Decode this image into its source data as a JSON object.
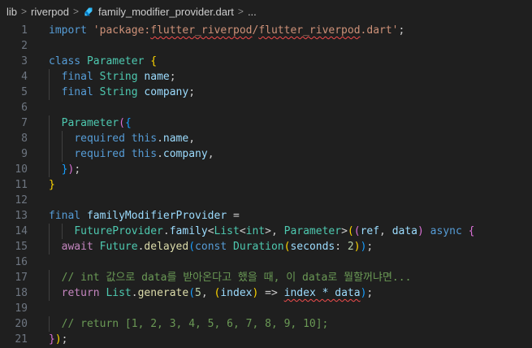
{
  "breadcrumb": {
    "items": [
      "lib",
      "riverpod",
      "family_modifier_provider.dart",
      "..."
    ],
    "separator": ">"
  },
  "editor": {
    "lines": [
      {
        "n": "1",
        "t": [
          [
            "kw",
            "import"
          ],
          [
            "punc",
            " "
          ],
          [
            "st",
            "'package:"
          ],
          [
            "st squig",
            "flutter_riverpod"
          ],
          [
            "st",
            "/"
          ],
          [
            "st squig",
            "flutter_riverpod"
          ],
          [
            "st",
            ".dart'"
          ],
          [
            "punc",
            ";"
          ]
        ]
      },
      {
        "n": "2",
        "t": []
      },
      {
        "n": "3",
        "t": [
          [
            "kw",
            "class"
          ],
          [
            "punc",
            " "
          ],
          [
            "ty",
            "Parameter"
          ],
          [
            "punc",
            " "
          ],
          [
            "br1",
            "{"
          ]
        ]
      },
      {
        "n": "4",
        "t": [
          [
            "punc",
            "  "
          ],
          [
            "kw",
            "final"
          ],
          [
            "punc",
            " "
          ],
          [
            "ty",
            "String"
          ],
          [
            "punc",
            " "
          ],
          [
            "var",
            "name"
          ],
          [
            "punc",
            ";"
          ]
        ]
      },
      {
        "n": "5",
        "t": [
          [
            "punc",
            "  "
          ],
          [
            "kw",
            "final"
          ],
          [
            "punc",
            " "
          ],
          [
            "ty",
            "String"
          ],
          [
            "punc",
            " "
          ],
          [
            "var",
            "company"
          ],
          [
            "punc",
            ";"
          ]
        ]
      },
      {
        "n": "6",
        "t": []
      },
      {
        "n": "7",
        "t": [
          [
            "punc",
            "  "
          ],
          [
            "ty",
            "Parameter"
          ],
          [
            "br2",
            "("
          ],
          [
            "br3",
            "{"
          ]
        ]
      },
      {
        "n": "8",
        "t": [
          [
            "punc",
            "    "
          ],
          [
            "kw",
            "required"
          ],
          [
            "punc",
            " "
          ],
          [
            "kw",
            "this"
          ],
          [
            "punc",
            "."
          ],
          [
            "var",
            "name"
          ],
          [
            "punc",
            ","
          ]
        ]
      },
      {
        "n": "9",
        "t": [
          [
            "punc",
            "    "
          ],
          [
            "kw",
            "required"
          ],
          [
            "punc",
            " "
          ],
          [
            "kw",
            "this"
          ],
          [
            "punc",
            "."
          ],
          [
            "var",
            "company"
          ],
          [
            "punc",
            ","
          ]
        ]
      },
      {
        "n": "10",
        "t": [
          [
            "punc",
            "  "
          ],
          [
            "br3",
            "}"
          ],
          [
            "br2",
            ")"
          ],
          [
            "punc",
            ";"
          ]
        ]
      },
      {
        "n": "11",
        "t": [
          [
            "br1",
            "}"
          ]
        ]
      },
      {
        "n": "12",
        "t": []
      },
      {
        "n": "13",
        "t": [
          [
            "kw",
            "final"
          ],
          [
            "punc",
            " "
          ],
          [
            "var",
            "familyModifierProvider"
          ],
          [
            "punc",
            " ="
          ]
        ]
      },
      {
        "n": "14",
        "t": [
          [
            "punc",
            "    "
          ],
          [
            "ty",
            "FutureProvider"
          ],
          [
            "punc",
            "."
          ],
          [
            "var",
            "family"
          ],
          [
            "punc",
            "<"
          ],
          [
            "ty",
            "List"
          ],
          [
            "punc",
            "<"
          ],
          [
            "ty",
            "int"
          ],
          [
            "punc",
            ">, "
          ],
          [
            "ty",
            "Parameter"
          ],
          [
            "punc",
            ">"
          ],
          [
            "br1",
            "("
          ],
          [
            "br2",
            "("
          ],
          [
            "var",
            "ref"
          ],
          [
            "punc",
            ", "
          ],
          [
            "var",
            "data"
          ],
          [
            "br2",
            ")"
          ],
          [
            "punc",
            " "
          ],
          [
            "kw",
            "async"
          ],
          [
            "punc",
            " "
          ],
          [
            "br2",
            "{"
          ]
        ]
      },
      {
        "n": "15",
        "t": [
          [
            "punc",
            "  "
          ],
          [
            "kw2",
            "await"
          ],
          [
            "punc",
            " "
          ],
          [
            "ty",
            "Future"
          ],
          [
            "punc",
            "."
          ],
          [
            "fn",
            "delayed"
          ],
          [
            "br3",
            "("
          ],
          [
            "kw",
            "const"
          ],
          [
            "punc",
            " "
          ],
          [
            "ty",
            "Duration"
          ],
          [
            "br1",
            "("
          ],
          [
            "var",
            "seconds"
          ],
          [
            "punc",
            ": "
          ],
          [
            "num",
            "2"
          ],
          [
            "br1",
            ")"
          ],
          [
            "br3",
            ")"
          ],
          [
            "punc",
            ";"
          ]
        ]
      },
      {
        "n": "16",
        "t": []
      },
      {
        "n": "17",
        "t": [
          [
            "punc",
            "  "
          ],
          [
            "cm",
            "// int 값으로 data를 받아온다고 했을 때, 이 data로 뭘할꺼냐면..."
          ]
        ]
      },
      {
        "n": "18",
        "t": [
          [
            "punc",
            "  "
          ],
          [
            "kw2",
            "return"
          ],
          [
            "punc",
            " "
          ],
          [
            "ty",
            "List"
          ],
          [
            "punc",
            "."
          ],
          [
            "fn",
            "generate"
          ],
          [
            "br3",
            "("
          ],
          [
            "num",
            "5"
          ],
          [
            "punc",
            ", "
          ],
          [
            "br1",
            "("
          ],
          [
            "var",
            "index"
          ],
          [
            "br1",
            ")"
          ],
          [
            "punc",
            " => "
          ],
          [
            "var squig",
            "index * data"
          ],
          [
            "br3",
            ")"
          ],
          [
            "punc",
            ";"
          ]
        ]
      },
      {
        "n": "19",
        "t": []
      },
      {
        "n": "20",
        "t": [
          [
            "punc",
            "  "
          ],
          [
            "cm",
            "// return [1, 2, 3, 4, 5, 6, 7, 8, 9, 10];"
          ]
        ]
      },
      {
        "n": "21",
        "t": [
          [
            "br2",
            "}"
          ],
          [
            "br1",
            ")"
          ],
          [
            "punc",
            ";"
          ]
        ]
      }
    ]
  }
}
